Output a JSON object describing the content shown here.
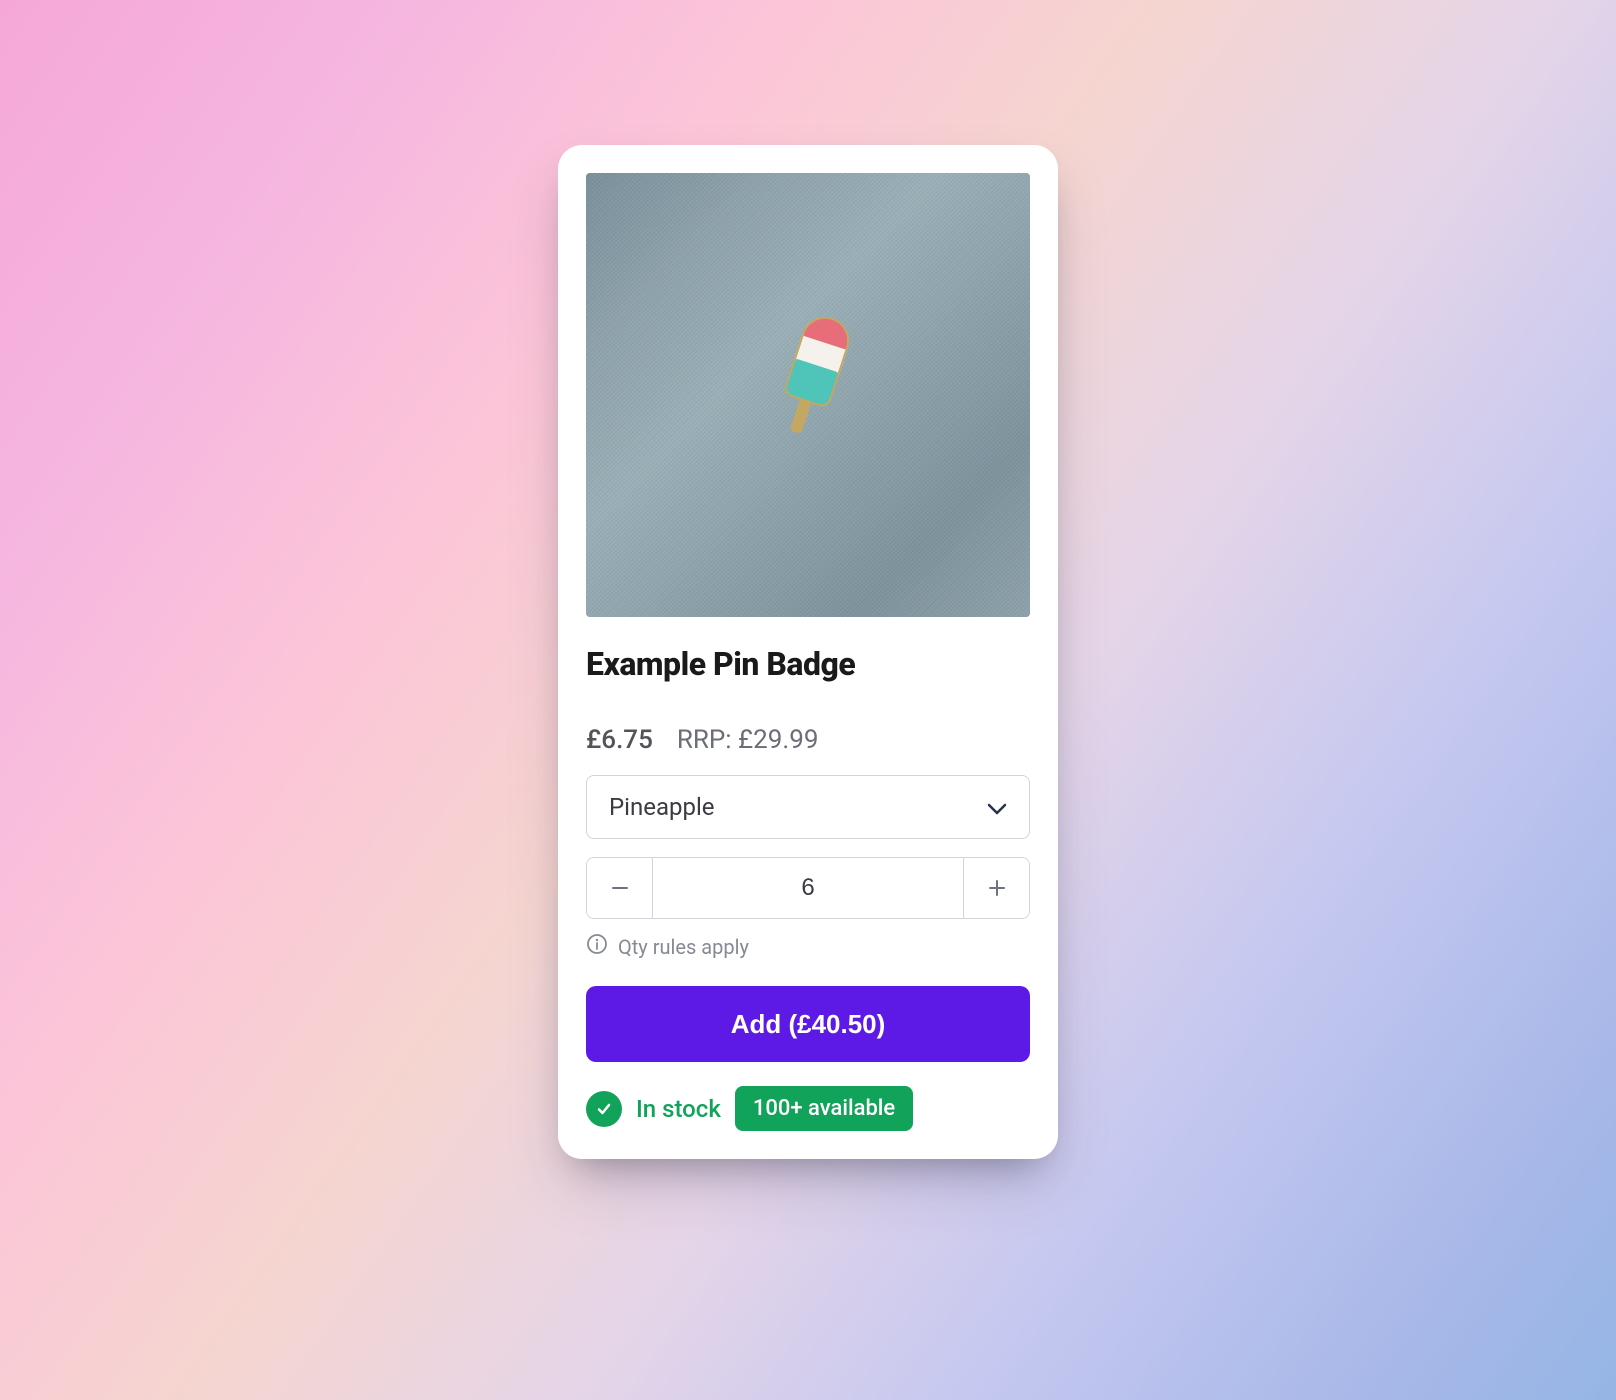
{
  "product": {
    "title": "Example Pin Badge",
    "price": "£6.75",
    "rrp": "RRP: £29.99",
    "variant": {
      "selected": "Pineapple"
    },
    "quantity": "6",
    "qty_rules_label": "Qty rules apply",
    "add_button_label": "Add (£40.50)",
    "stock": {
      "status": "In stock",
      "available_badge": "100+ available"
    }
  },
  "colors": {
    "accent": "#5d1ae6",
    "success": "#12a35a"
  },
  "icons": {
    "chevron_down": "chevron-down-icon",
    "minus": "minus-icon",
    "plus": "plus-icon",
    "info": "info-icon",
    "check": "check-icon"
  }
}
